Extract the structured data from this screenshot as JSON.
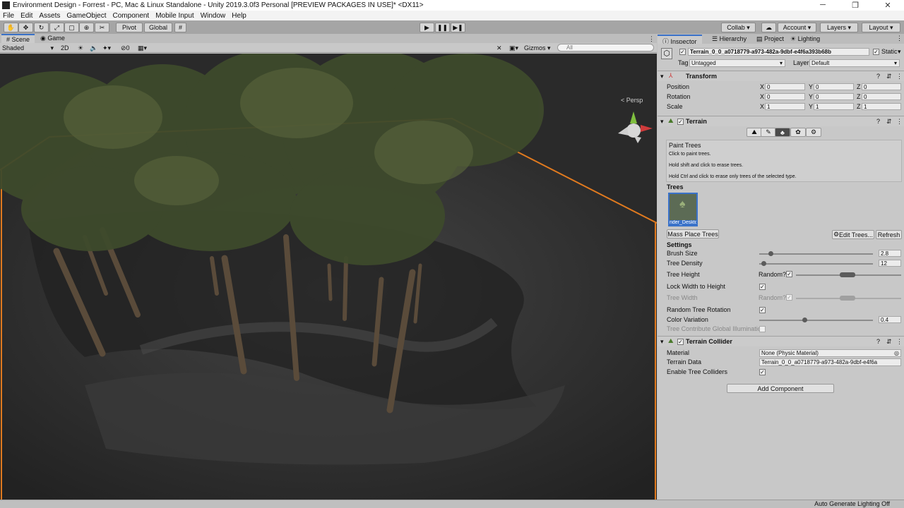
{
  "window": {
    "title": "Environment Design - Forrest - PC, Mac & Linux Standalone - Unity 2019.3.0f3 Personal [PREVIEW PACKAGES IN USE]* <DX11>",
    "controls": [
      "─",
      "❐",
      "✕"
    ]
  },
  "menu": [
    "File",
    "Edit",
    "Assets",
    "GameObject",
    "Component",
    "Mobile Input",
    "Window",
    "Help"
  ],
  "toolbar": {
    "pivot_label": "Pivot",
    "global_label": "Global",
    "collab_label": "Collab ▾",
    "account_label": "Account",
    "layers_label": "Layers",
    "layout_label": "Layout"
  },
  "scene_view": {
    "tabs": [
      "Scene",
      "Game"
    ],
    "shading_mode": "Shaded",
    "twod_label": "2D",
    "hidden_count": "0",
    "gizmos_label": "Gizmos",
    "search_placeholder": "All",
    "persp_label": "< Persp"
  },
  "inspector": {
    "tabs": [
      "Inspector",
      "Hierarchy",
      "Project",
      "Lighting"
    ],
    "object_name": "Terrain_0_0_a0718779-a973-482a-9dbf-e4f6a393b68b",
    "static_label": "Static",
    "tag_label": "Tag",
    "tag_value": "Untagged",
    "layer_label": "Layer",
    "layer_value": "Default",
    "transform": {
      "title": "Transform",
      "rows": [
        {
          "label": "Position",
          "x": "0",
          "y": "0",
          "z": "0"
        },
        {
          "label": "Rotation",
          "x": "0",
          "y": "0",
          "z": "0"
        },
        {
          "label": "Scale",
          "x": "1",
          "y": "1",
          "z": "1"
        }
      ]
    },
    "terrain": {
      "title": "Terrain",
      "paint_title": "Paint Trees",
      "help_lines": [
        "Click to paint trees.",
        "Hold shift and click to erase trees.",
        "Hold Ctrl and click to erase only trees of the selected type."
      ],
      "trees_heading": "Trees",
      "tree_thumb_label": "nder_Deskto",
      "mass_place_label": "Mass Place Trees",
      "edit_trees_label": "Edit Trees...",
      "refresh_label": "Refresh",
      "settings_heading": "Settings",
      "brush_size_label": "Brush Size",
      "brush_size_value": "2.8",
      "brush_size_fraction": 0.1,
      "tree_density_label": "Tree Density",
      "tree_density_value": "12",
      "tree_density_fraction": 0.04,
      "tree_height_label": "Tree Height",
      "random_label": "Random?",
      "lock_width_label": "Lock Width to Height",
      "tree_width_label": "Tree Width",
      "random_rotation_label": "Random Tree Rotation",
      "color_variation_label": "Color Variation",
      "color_variation_value": "0.4",
      "color_variation_fraction": 0.4,
      "global_illum_label": "Tree Contribute Global Illumination"
    },
    "collider": {
      "title": "Terrain Collider",
      "material_label": "Material",
      "material_value": "None (Physic Material)",
      "data_label": "Terrain Data",
      "data_value": "Terrain_0_0_a0718779-a973-482a-9dbf-e4f6a",
      "enable_colliders_label": "Enable Tree Colliders"
    },
    "add_component_label": "Add Component"
  },
  "status": {
    "right_text": "Auto Generate Lighting Off"
  },
  "colors": {
    "selection_outline": "#e07a1f",
    "accent": "#3a72c9"
  }
}
